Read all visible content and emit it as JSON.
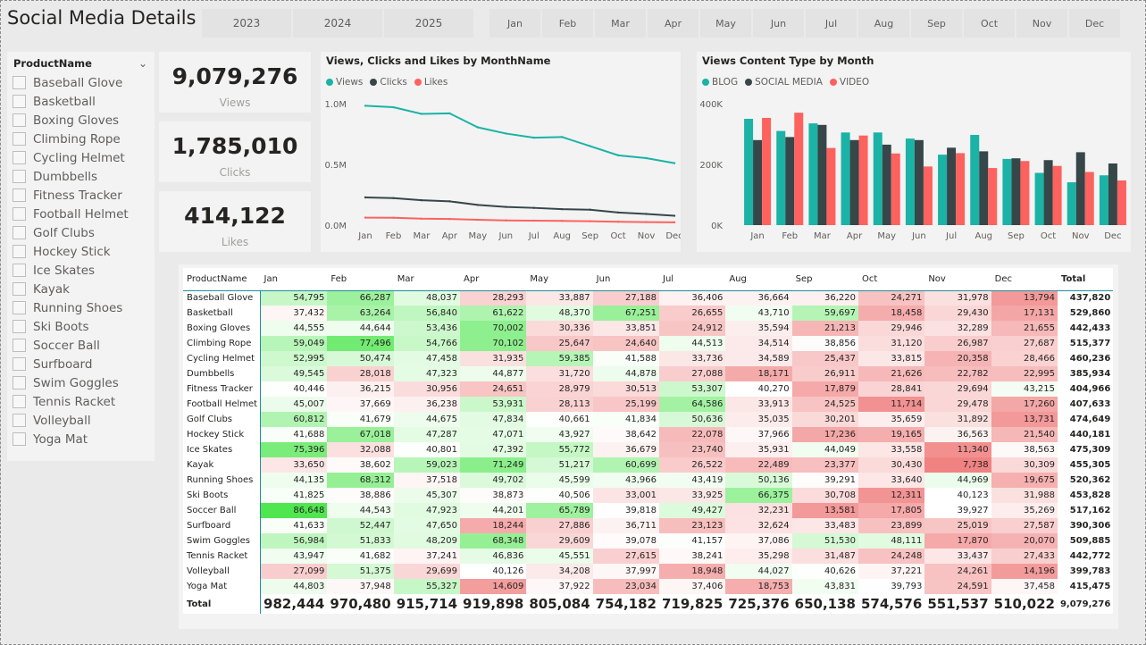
{
  "title": "Social Media Details",
  "years": [
    "2023",
    "2024",
    "2025"
  ],
  "months": [
    "Jan",
    "Feb",
    "Mar",
    "Apr",
    "May",
    "Jun",
    "Jul",
    "Aug",
    "Sep",
    "Oct",
    "Nov",
    "Dec"
  ],
  "product_slicer": {
    "header": "ProductName",
    "items": [
      "Baseball Glove",
      "Basketball",
      "Boxing Gloves",
      "Climbing Rope",
      "Cycling Helmet",
      "Dumbbells",
      "Fitness Tracker",
      "Football Helmet",
      "Golf Clubs",
      "Hockey Stick",
      "Ice Skates",
      "Kayak",
      "Running Shoes",
      "Ski Boots",
      "Soccer Ball",
      "Surfboard",
      "Swim Goggles",
      "Tennis Racket",
      "Volleyball",
      "Yoga Mat"
    ]
  },
  "cards": {
    "views": {
      "value": "9,079,276",
      "label": "Views"
    },
    "clicks": {
      "value": "1,785,010",
      "label": "Clicks"
    },
    "likes": {
      "value": "414,122",
      "label": "Likes"
    }
  },
  "colors": {
    "views": "#1ab3a6",
    "clicks": "#374649",
    "likes": "#fd625e"
  },
  "chart_data": [
    {
      "type": "line",
      "title": "Views, Clicks and Likes by MonthName",
      "categories": [
        "Jan",
        "Feb",
        "Mar",
        "Apr",
        "May",
        "Jun",
        "Jul",
        "Aug",
        "Sep",
        "Oct",
        "Nov",
        "Dec"
      ],
      "y_ticks": [
        "0.0M",
        "0.5M",
        "1.0M"
      ],
      "ylim": [
        0,
        1000000
      ],
      "series": [
        {
          "name": "Views",
          "color": "#1ab3a6",
          "values": [
            982444,
            970480,
            915714,
            919898,
            805084,
            754182,
            719825,
            725376,
            650138,
            574576,
            551537,
            510022
          ]
        },
        {
          "name": "Clicks",
          "color": "#374649",
          "values": [
            228000,
            222000,
            205000,
            196000,
            166000,
            150000,
            142000,
            131000,
            127000,
            104000,
            92000,
            77000
          ]
        },
        {
          "name": "Likes",
          "color": "#fd625e",
          "values": [
            62000,
            61000,
            53000,
            51000,
            44000,
            39000,
            37000,
            35000,
            32000,
            28000,
            25000,
            23000
          ]
        }
      ]
    },
    {
      "type": "bar",
      "title": "Views Content Type by Month",
      "categories": [
        "Jan",
        "Feb",
        "Mar",
        "Apr",
        "May",
        "Jun",
        "Jul",
        "Aug",
        "Sep",
        "Oct",
        "Nov",
        "Dec"
      ],
      "y_ticks": [
        "0K",
        "200K",
        "400K"
      ],
      "ylim": [
        0,
        400000
      ],
      "series": [
        {
          "name": "BLOG",
          "color": "#1ab3a6",
          "values": [
            350000,
            310000,
            335000,
            305000,
            305000,
            285000,
            232000,
            297000,
            218000,
            172000,
            141000,
            164000
          ]
        },
        {
          "name": "SOCIAL MEDIA",
          "color": "#374649",
          "values": [
            280000,
            290000,
            330000,
            280000,
            265000,
            280000,
            255000,
            243000,
            220000,
            214000,
            240000,
            203000
          ]
        },
        {
          "name": "VIDEO",
          "color": "#fd625e",
          "values": [
            353000,
            370000,
            254000,
            295000,
            236000,
            193000,
            237000,
            188000,
            211000,
            195000,
            175000,
            147000
          ]
        }
      ]
    },
    {
      "type": "table",
      "headers": [
        "ProductName",
        "Jan",
        "Feb",
        "Mar",
        "Apr",
        "May",
        "Jun",
        "Jul",
        "Aug",
        "Sep",
        "Oct",
        "Nov",
        "Dec",
        "Total"
      ],
      "rows": [
        [
          "Baseball Glove",
          "54,795",
          "66,287",
          "48,037",
          "28,293",
          "33,887",
          "27,188",
          "36,406",
          "36,664",
          "36,220",
          "24,271",
          "31,978",
          "13,794",
          "437,820"
        ],
        [
          "Basketball",
          "37,432",
          "63,264",
          "56,840",
          "61,622",
          "48,370",
          "67,251",
          "26,655",
          "43,710",
          "59,697",
          "18,458",
          "29,430",
          "17,131",
          "529,860"
        ],
        [
          "Boxing Gloves",
          "44,555",
          "44,644",
          "53,436",
          "70,002",
          "30,336",
          "33,851",
          "24,912",
          "35,594",
          "21,213",
          "29,946",
          "32,289",
          "21,655",
          "442,433"
        ],
        [
          "Climbing Rope",
          "59,049",
          "77,496",
          "54,766",
          "70,102",
          "25,647",
          "24,640",
          "44,513",
          "34,514",
          "38,856",
          "31,120",
          "26,987",
          "27,687",
          "515,377"
        ],
        [
          "Cycling Helmet",
          "52,995",
          "50,474",
          "47,458",
          "31,935",
          "59,385",
          "41,588",
          "33,736",
          "34,589",
          "25,437",
          "33,815",
          "20,358",
          "28,466",
          "460,236"
        ],
        [
          "Dumbbells",
          "49,545",
          "28,018",
          "47,323",
          "44,877",
          "31,720",
          "44,878",
          "27,088",
          "18,171",
          "26,911",
          "21,626",
          "22,782",
          "22,995",
          "385,934"
        ],
        [
          "Fitness Tracker",
          "40,446",
          "36,215",
          "30,956",
          "24,651",
          "28,979",
          "30,513",
          "53,307",
          "40,270",
          "17,879",
          "28,841",
          "29,694",
          "43,215",
          "404,966"
        ],
        [
          "Football Helmet",
          "45,007",
          "37,669",
          "36,238",
          "53,931",
          "28,113",
          "25,199",
          "64,586",
          "33,913",
          "24,525",
          "11,714",
          "29,478",
          "17,260",
          "407,633"
        ],
        [
          "Golf Clubs",
          "60,812",
          "41,679",
          "44,675",
          "47,834",
          "40,661",
          "41,834",
          "50,636",
          "35,035",
          "30,201",
          "35,659",
          "31,892",
          "13,731",
          "474,649"
        ],
        [
          "Hockey Stick",
          "41,688",
          "67,018",
          "47,287",
          "47,071",
          "43,927",
          "38,642",
          "22,078",
          "37,966",
          "17,236",
          "19,165",
          "36,563",
          "21,540",
          "440,181"
        ],
        [
          "Ice Skates",
          "75,396",
          "32,088",
          "40,801",
          "47,392",
          "55,772",
          "36,679",
          "23,740",
          "35,931",
          "44,049",
          "33,558",
          "11,340",
          "38,563",
          "475,309"
        ],
        [
          "Kayak",
          "33,650",
          "38,602",
          "59,023",
          "71,249",
          "51,217",
          "60,699",
          "26,522",
          "22,489",
          "23,377",
          "30,430",
          "7,738",
          "30,309",
          "455,305"
        ],
        [
          "Running Shoes",
          "44,135",
          "68,312",
          "37,518",
          "49,702",
          "45,599",
          "43,966",
          "43,419",
          "50,136",
          "39,291",
          "33,640",
          "44,969",
          "19,675",
          "520,362"
        ],
        [
          "Ski Boots",
          "41,825",
          "38,886",
          "45,307",
          "38,873",
          "40,506",
          "33,001",
          "33,925",
          "66,375",
          "30,708",
          "12,311",
          "40,123",
          "31,988",
          "453,828"
        ],
        [
          "Soccer Ball",
          "86,648",
          "44,543",
          "47,923",
          "44,201",
          "65,789",
          "39,818",
          "49,427",
          "32,231",
          "13,581",
          "17,805",
          "39,927",
          "35,269",
          "517,162"
        ],
        [
          "Surfboard",
          "41,633",
          "52,447",
          "47,650",
          "18,244",
          "27,886",
          "36,711",
          "23,123",
          "32,624",
          "33,483",
          "23,899",
          "25,019",
          "27,587",
          "390,306"
        ],
        [
          "Swim Goggles",
          "56,984",
          "51,833",
          "48,209",
          "68,348",
          "29,609",
          "39,078",
          "41,157",
          "37,086",
          "51,530",
          "48,111",
          "17,870",
          "20,070",
          "509,885"
        ],
        [
          "Tennis Racket",
          "43,947",
          "41,682",
          "37,241",
          "46,836",
          "45,551",
          "27,615",
          "38,241",
          "35,298",
          "31,487",
          "24,248",
          "33,437",
          "27,433",
          "442,772"
        ],
        [
          "Volleyball",
          "27,099",
          "51,375",
          "29,699",
          "40,126",
          "34,208",
          "37,997",
          "18,948",
          "44,027",
          "40,626",
          "37,221",
          "24,261",
          "14,196",
          "399,783"
        ],
        [
          "Yoga Mat",
          "44,803",
          "37,948",
          "55,327",
          "14,609",
          "37,922",
          "23,034",
          "37,406",
          "18,753",
          "43,831",
          "39,793",
          "24,591",
          "37,458",
          "415,475"
        ]
      ],
      "total_row": [
        "Total",
        "982,444",
        "970,480",
        "915,714",
        "919,898",
        "805,084",
        "754,182",
        "719,825",
        "725,376",
        "650,138",
        "574,576",
        "551,537",
        "510,022",
        "9,079,276"
      ]
    }
  ]
}
